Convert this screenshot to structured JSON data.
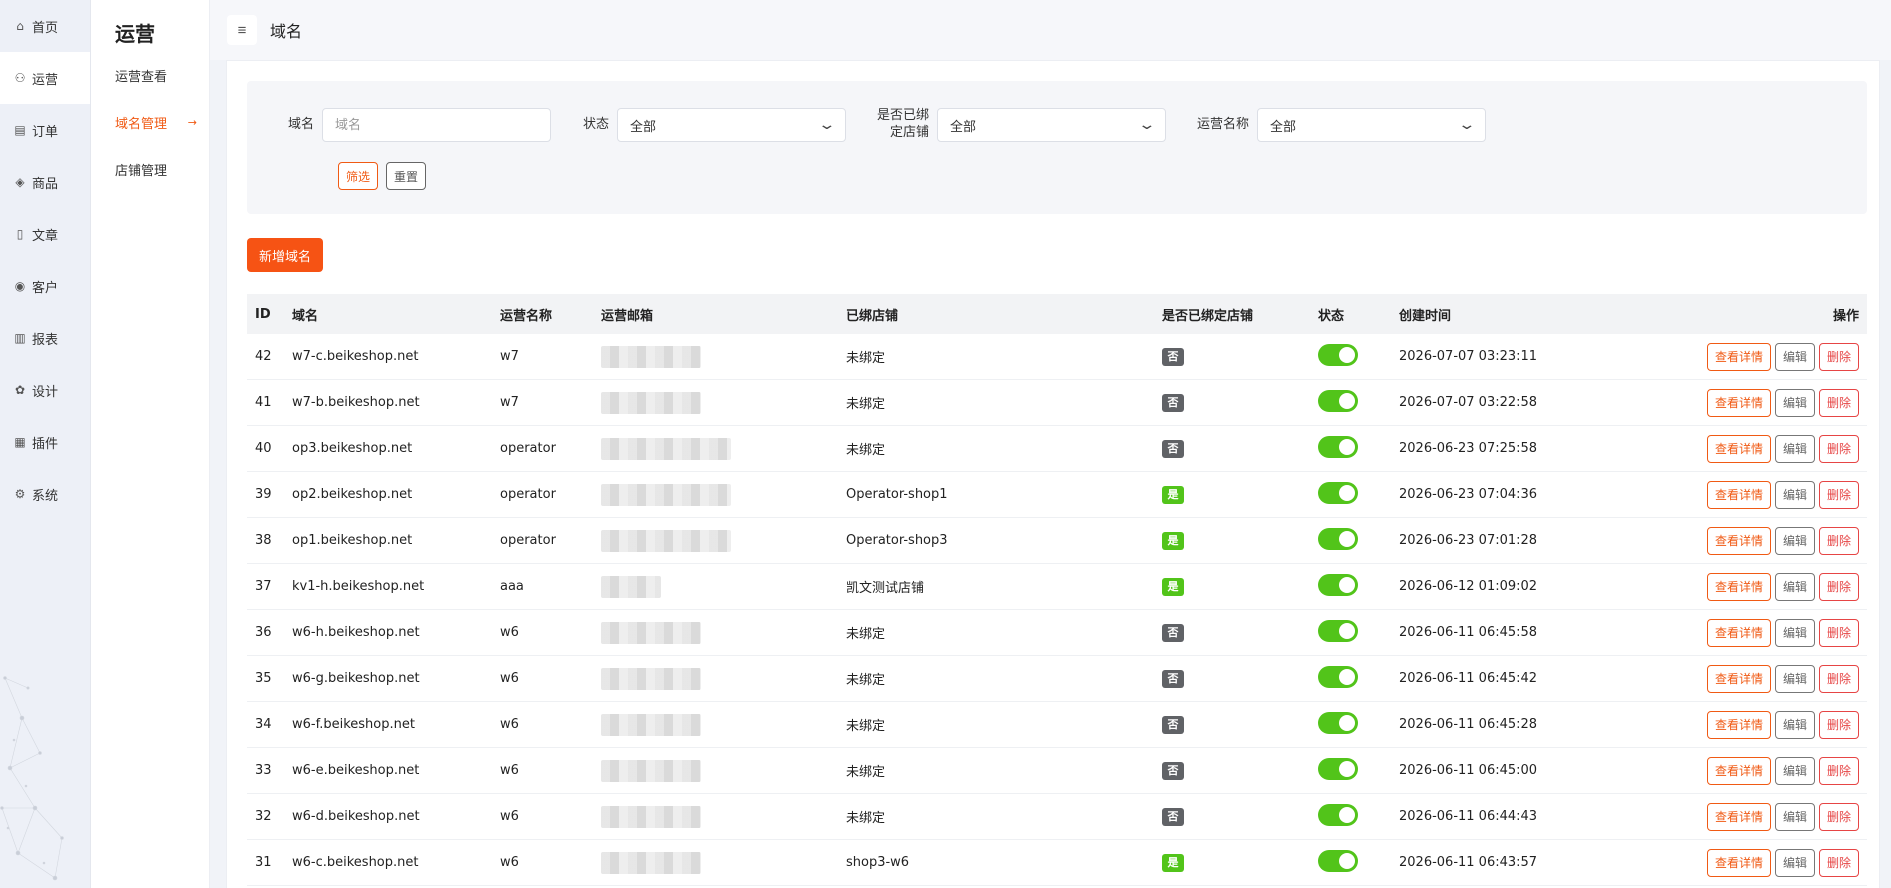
{
  "rail": {
    "items": [
      {
        "label": "首页",
        "icon": "home-icon",
        "glyph": "⌂"
      },
      {
        "label": "运营",
        "icon": "users-icon",
        "glyph": "⚇"
      },
      {
        "label": "订单",
        "icon": "clipboard-icon",
        "glyph": "▤"
      },
      {
        "label": "商品",
        "icon": "box-icon",
        "glyph": "◈"
      },
      {
        "label": "文章",
        "icon": "document-icon",
        "glyph": "▯"
      },
      {
        "label": "客户",
        "icon": "user-circle-icon",
        "glyph": "◉"
      },
      {
        "label": "报表",
        "icon": "bar-chart-icon",
        "glyph": "▥"
      },
      {
        "label": "设计",
        "icon": "palette-icon",
        "glyph": "✿"
      },
      {
        "label": "插件",
        "icon": "plugin-icon",
        "glyph": "▦"
      },
      {
        "label": "系统",
        "icon": "gear-icon",
        "glyph": "⚙"
      }
    ]
  },
  "subnav": {
    "title": "运营",
    "items": [
      {
        "label": "运营查看"
      },
      {
        "label": "域名管理",
        "arrow": "→"
      },
      {
        "label": "店铺管理"
      }
    ]
  },
  "header": {
    "menu_glyph": "≡",
    "title": "域名"
  },
  "filters": {
    "domain_label": "域名",
    "domain_placeholder": "域名",
    "status_label": "状态",
    "status_value": "全部",
    "bound_label_line1": "是否已绑",
    "bound_label_line2": "定店铺",
    "bound_value": "全部",
    "operator_label": "运营名称",
    "operator_value": "全部",
    "chevron": "⌄",
    "filter_button": "筛选",
    "reset_button": "重置"
  },
  "add_button": "新增域名",
  "table": {
    "headers": {
      "id": "ID",
      "domain": "域名",
      "operator": "运营名称",
      "email": "运营邮箱",
      "shop": "已绑店铺",
      "bound": "是否已绑定店铺",
      "status": "状态",
      "created": "创建时间",
      "actions": "操作"
    },
    "actions": {
      "view": "查看详情",
      "edit": "编辑",
      "delete": "删除"
    },
    "rows": [
      {
        "id": "42",
        "domain": "w7-c.beikeshop.net",
        "operator": "w7",
        "shop": "未绑定",
        "bound": "否",
        "created": "2026-07-07 03:23:11"
      },
      {
        "id": "41",
        "domain": "w7-b.beikeshop.net",
        "operator": "w7",
        "shop": "未绑定",
        "bound": "否",
        "created": "2026-07-07 03:22:58"
      },
      {
        "id": "40",
        "domain": "op3.beikeshop.net",
        "operator": "operator",
        "shop": "未绑定",
        "bound": "否",
        "created": "2026-06-23 07:25:58"
      },
      {
        "id": "39",
        "domain": "op2.beikeshop.net",
        "operator": "operator",
        "shop": "Operator-shop1",
        "bound": "是",
        "created": "2026-06-23 07:04:36"
      },
      {
        "id": "38",
        "domain": "op1.beikeshop.net",
        "operator": "operator",
        "shop": "Operator-shop3",
        "bound": "是",
        "created": "2026-06-23 07:01:28"
      },
      {
        "id": "37",
        "domain": "kv1-h.beikeshop.net",
        "operator": "aaa",
        "shop": "凯文测试店铺",
        "bound": "是",
        "created": "2026-06-12 01:09:02"
      },
      {
        "id": "36",
        "domain": "w6-h.beikeshop.net",
        "operator": "w6",
        "shop": "未绑定",
        "bound": "否",
        "created": "2026-06-11 06:45:58"
      },
      {
        "id": "35",
        "domain": "w6-g.beikeshop.net",
        "operator": "w6",
        "shop": "未绑定",
        "bound": "否",
        "created": "2026-06-11 06:45:42"
      },
      {
        "id": "34",
        "domain": "w6-f.beikeshop.net",
        "operator": "w6",
        "shop": "未绑定",
        "bound": "否",
        "created": "2026-06-11 06:45:28"
      },
      {
        "id": "33",
        "domain": "w6-e.beikeshop.net",
        "operator": "w6",
        "shop": "未绑定",
        "bound": "否",
        "created": "2026-06-11 06:45:00"
      },
      {
        "id": "32",
        "domain": "w6-d.beikeshop.net",
        "operator": "w6",
        "shop": "未绑定",
        "bound": "否",
        "created": "2026-06-11 06:44:43"
      },
      {
        "id": "31",
        "domain": "w6-c.beikeshop.net",
        "operator": "w6",
        "shop": "shop3-w6",
        "bound": "是",
        "created": "2026-06-11 06:43:57"
      }
    ]
  },
  "colors": {
    "accent": "#f65314",
    "switch_on": "#52c41a",
    "tag_no": "#606266",
    "tag_yes": "#52c41a",
    "danger": "#e64545"
  }
}
